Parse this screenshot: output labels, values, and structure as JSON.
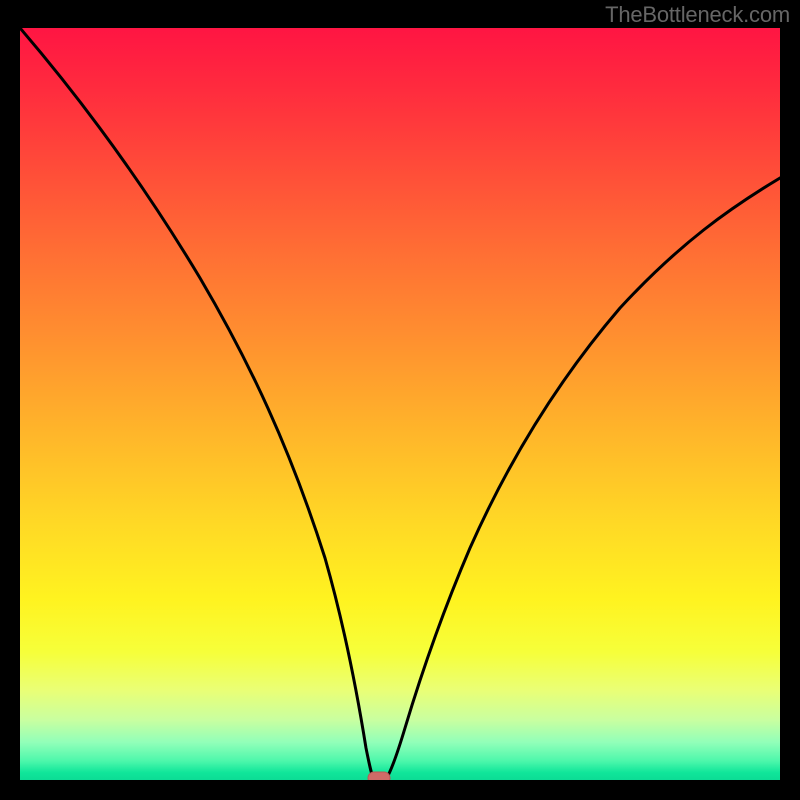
{
  "watermark": "TheBottleneck.com",
  "chart_data": {
    "type": "line",
    "title": "",
    "xlabel": "",
    "ylabel": "",
    "xlim": [
      0,
      100
    ],
    "ylim": [
      0,
      100
    ],
    "series": [
      {
        "name": "bottleneck-curve",
        "x": [
          0,
          5,
          10,
          15,
          20,
          25,
          30,
          35,
          40,
          42,
          44,
          46,
          47,
          48,
          50,
          53,
          56,
          60,
          65,
          70,
          75,
          80,
          85,
          90,
          95,
          100
        ],
        "y": [
          100,
          91,
          82,
          73,
          64,
          55,
          46,
          36,
          23,
          15,
          7,
          1,
          0,
          0,
          3,
          11,
          19,
          28,
          37,
          45,
          52,
          58,
          63,
          68,
          72,
          76
        ]
      }
    ],
    "annotations": [
      {
        "name": "optimum-marker",
        "x": 47,
        "y": 0,
        "color": "#d46a6a",
        "shape": "pill"
      }
    ],
    "gradient_stops": [
      {
        "pos": 0,
        "color": "#ff1543"
      },
      {
        "pos": 8,
        "color": "#ff2b3e"
      },
      {
        "pos": 18,
        "color": "#ff4a39"
      },
      {
        "pos": 30,
        "color": "#ff6f34"
      },
      {
        "pos": 42,
        "color": "#ff922f"
      },
      {
        "pos": 54,
        "color": "#ffb62a"
      },
      {
        "pos": 66,
        "color": "#ffd925"
      },
      {
        "pos": 76,
        "color": "#fff320"
      },
      {
        "pos": 83,
        "color": "#f6ff3a"
      },
      {
        "pos": 88,
        "color": "#eaff75"
      },
      {
        "pos": 92,
        "color": "#c9ffa0"
      },
      {
        "pos": 95,
        "color": "#91ffb9"
      },
      {
        "pos": 97.5,
        "color": "#4cf7ab"
      },
      {
        "pos": 99,
        "color": "#10e69a"
      },
      {
        "pos": 100,
        "color": "#0cdc95"
      }
    ]
  }
}
